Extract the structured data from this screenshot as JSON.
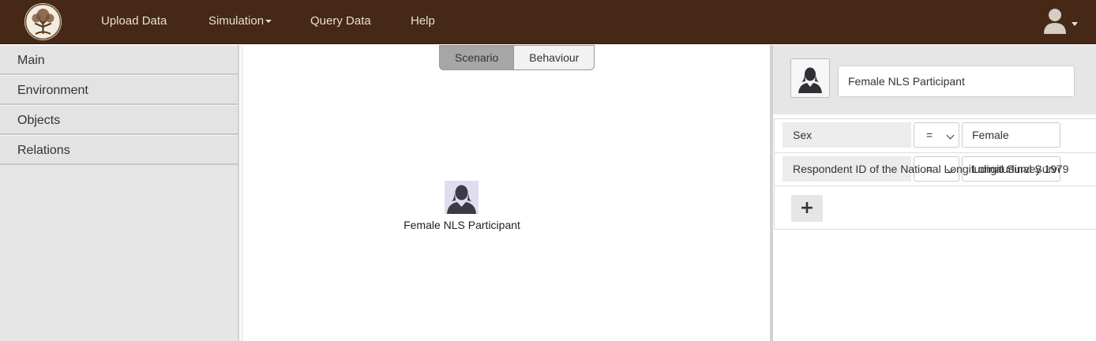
{
  "nav": {
    "logo_icon": "tree-logo-icon",
    "items": [
      {
        "label": "Upload Data"
      },
      {
        "label": "Simulation",
        "dropdown": true
      },
      {
        "label": "Query Data"
      },
      {
        "label": "Help"
      }
    ],
    "user_icon": "user-icon"
  },
  "sidebar": {
    "items": [
      {
        "label": "Main"
      },
      {
        "label": "Environment"
      },
      {
        "label": "Objects"
      },
      {
        "label": "Relations"
      }
    ]
  },
  "canvas": {
    "tabs": [
      {
        "label": "Scenario",
        "active": true
      },
      {
        "label": "Behaviour",
        "active": false
      }
    ],
    "node": {
      "label": "Female NLS Participant",
      "icon": "female-person-icon"
    }
  },
  "panel": {
    "name_value": "Female NLS Participant",
    "attributes": [
      {
        "name": "Sex",
        "operator": "=",
        "value": "Female"
      },
      {
        "name": "Respondent ID of the National Longitudinal Survey 1979",
        "operator": "=",
        "value": "Longitudinal Survey 1979"
      }
    ],
    "add_label": "+"
  },
  "colors": {
    "navbar": "#452816",
    "sidebar": "#e6e6e6",
    "node_bg": "#e1dcef"
  }
}
